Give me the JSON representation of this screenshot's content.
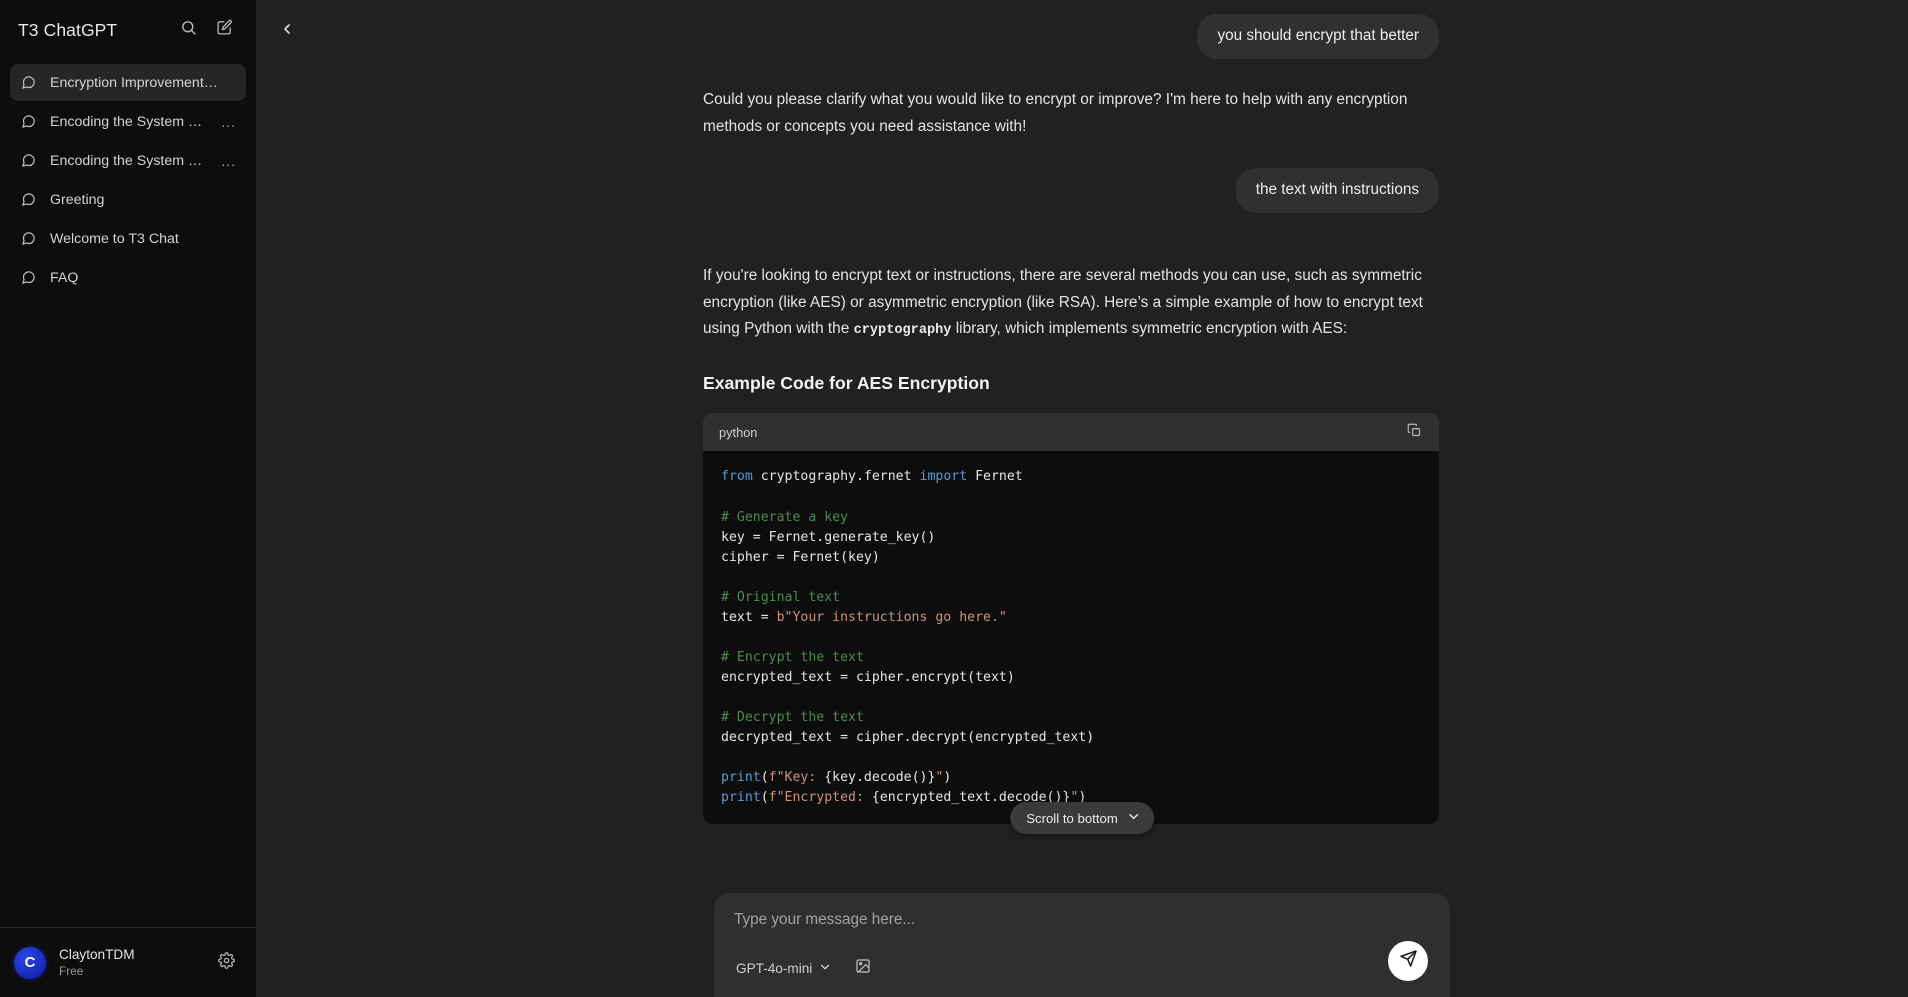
{
  "sidebar": {
    "brand": "T3 ChatGPT",
    "search_icon": "search-icon",
    "new_chat_icon": "new-chat-icon",
    "items": [
      {
        "label": "Encryption Improvement S...",
        "active": true,
        "ellipsis": ""
      },
      {
        "label": "Encoding the System Pro",
        "active": false,
        "ellipsis": "..."
      },
      {
        "label": "Encoding the System Pro",
        "active": false,
        "ellipsis": "..."
      },
      {
        "label": "Greeting",
        "active": false,
        "ellipsis": ""
      },
      {
        "label": "Welcome to T3 Chat",
        "active": false,
        "ellipsis": ""
      },
      {
        "label": "FAQ",
        "active": false,
        "ellipsis": ""
      }
    ],
    "footer": {
      "avatar_letter": "C",
      "user_name": "ClaytonTDM",
      "plan": "Free",
      "settings_icon": "gear-icon"
    }
  },
  "main": {
    "collapse_icon": "chevron-left-icon",
    "messages": [
      {
        "role": "user",
        "text": "you should encrypt that better"
      },
      {
        "role": "assistant",
        "text": "Could you please clarify what you would like to encrypt or improve? I'm here to help with any encryption methods or concepts you need assistance with!"
      },
      {
        "role": "user",
        "text": "the text with instructions"
      }
    ],
    "answer": {
      "part1": "If you're looking to encrypt text or instructions, there are several methods you can use, such as symmetric encryption (like AES) or asymmetric encryption (like RSA). Here’s a simple example of how to encrypt text using Python with the ",
      "inline_code": "cryptography",
      "part2": " library, which implements symmetric encryption with AES:",
      "heading": "Example Code for AES Encryption"
    },
    "code_block": {
      "language": "python",
      "copy_icon": "copy-icon",
      "lines": [
        [
          {
            "t": "from ",
            "c": "kw"
          },
          {
            "t": "cryptography.fernet ",
            "c": "pl"
          },
          {
            "t": "import ",
            "c": "kw"
          },
          {
            "t": "Fernet",
            "c": "pl"
          }
        ],
        [],
        [
          {
            "t": "# Generate a key",
            "c": "com"
          }
        ],
        [
          {
            "t": "key = Fernet.generate_key()",
            "c": "pl"
          }
        ],
        [
          {
            "t": "cipher = Fernet(key)",
            "c": "pl"
          }
        ],
        [],
        [
          {
            "t": "# Original text",
            "c": "com"
          }
        ],
        [
          {
            "t": "text = ",
            "c": "pl"
          },
          {
            "t": "b\"Your instructions go here.\"",
            "c": "str"
          }
        ],
        [],
        [
          {
            "t": "# Encrypt the text",
            "c": "com"
          }
        ],
        [
          {
            "t": "encrypted_text = cipher.encrypt(text)",
            "c": "pl"
          }
        ],
        [],
        [
          {
            "t": "# Decrypt the text",
            "c": "com"
          }
        ],
        [
          {
            "t": "decrypted_text = cipher.decrypt(encrypted_text)",
            "c": "pl"
          }
        ],
        [],
        [
          {
            "t": "print",
            "c": "fn"
          },
          {
            "t": "(",
            "c": "pl"
          },
          {
            "t": "f\"Key: ",
            "c": "str"
          },
          {
            "t": "{key.decode()}",
            "c": "pl"
          },
          {
            "t": "\"",
            "c": "str"
          },
          {
            "t": ")",
            "c": "pl"
          }
        ],
        [
          {
            "t": "print",
            "c": "fn"
          },
          {
            "t": "(",
            "c": "pl"
          },
          {
            "t": "f\"Encrypted: ",
            "c": "str"
          },
          {
            "t": "{encrypted_text.decode()}",
            "c": "pl"
          },
          {
            "t": "\"",
            "c": "str"
          },
          {
            "t": ")",
            "c": "pl"
          }
        ]
      ]
    },
    "scroll_pill": {
      "label": "Scroll to bottom",
      "icon": "chevron-down-icon"
    },
    "composer": {
      "placeholder": "Type your message here...",
      "value": "",
      "model": "GPT-4o-mini",
      "model_caret_icon": "chevron-down-icon",
      "attach_icon": "image-icon",
      "send_icon": "send-icon"
    }
  },
  "colors": {
    "sidebar_bg": "#0d0d0d",
    "main_bg": "#212121",
    "bubble_bg": "#303030",
    "code_bg": "#0d0d0d",
    "accent_avatar": "#1a2fc4",
    "send_bg": "#ffffff"
  }
}
